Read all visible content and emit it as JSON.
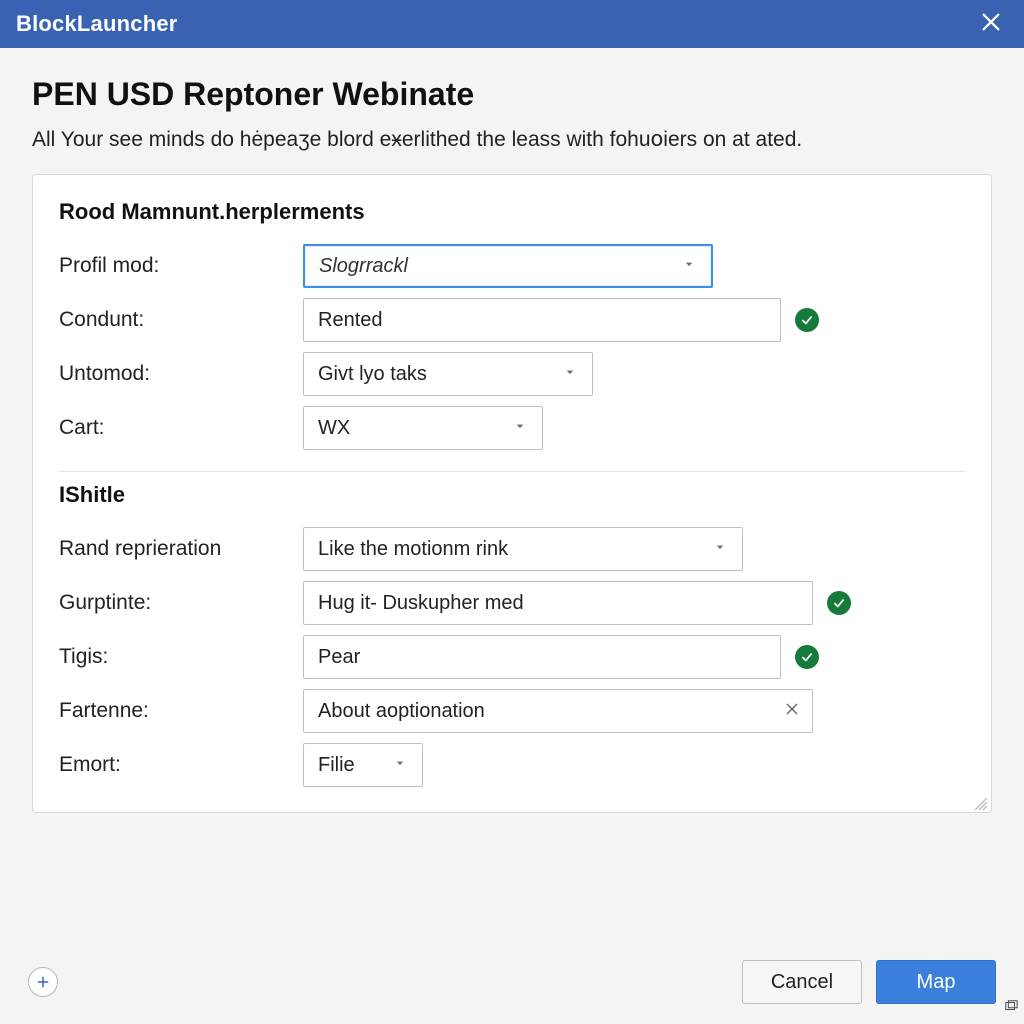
{
  "titlebar": {
    "title": "BlockLauncher"
  },
  "header": {
    "title": "PEN USD Reptoner Webinate",
    "subtitle": "All Your see minds do hėpeaӡe blord eӿerlithed the leass with fohuօiers on at ated."
  },
  "section1": {
    "title": "Rood Mamnunt.herplerments",
    "rows": {
      "profil_mod": {
        "label": "Profil mod:",
        "value": "Slogrrackl"
      },
      "condunt": {
        "label": "Condunt:",
        "value": "Rented"
      },
      "untomod": {
        "label": "Untomod:",
        "value": "Givt lyo taks"
      },
      "cart": {
        "label": "Cart:",
        "value": "WX"
      }
    }
  },
  "section2": {
    "title": "IShitle",
    "rows": {
      "rand": {
        "label": "Rand reprieration",
        "value": "Like the motionm rink"
      },
      "gurptinte": {
        "label": "Gurptinte:",
        "value": "Hug it- Duskupher med"
      },
      "tigis": {
        "label": "Tigis:",
        "value": "Pear"
      },
      "fartenne": {
        "label": "Fartenne:",
        "value": "About aoptionation"
      },
      "emort": {
        "label": "Emort:",
        "value": "Filie"
      }
    }
  },
  "footer": {
    "cancel": "Cancel",
    "primary": "Map"
  }
}
